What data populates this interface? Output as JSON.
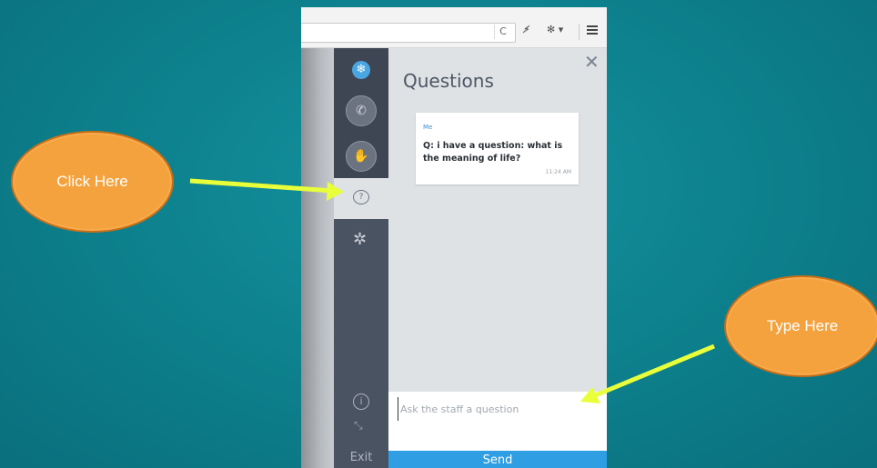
{
  "toolbar": {
    "reload_glyph": "C",
    "extension_glyph": "⚡̸",
    "extra_glyph": "✻ ▾"
  },
  "sidebar": {
    "logo_glyph": "❄",
    "phone_glyph": "✆",
    "hand_glyph": "✋",
    "questions_glyph": "?",
    "settings_glyph": "✲",
    "info_glyph": "i",
    "expand_glyph": "⤡",
    "exit_label": "Exit"
  },
  "panel": {
    "title": "Questions",
    "close_glyph": "✕",
    "message": {
      "author": "Me",
      "prefix": "Q:",
      "text": "i have a question: what is the meaning of life?",
      "time": "11:24 AM"
    },
    "input_placeholder": "Ask the staff a question",
    "send_label": "Send"
  },
  "annotations": {
    "left_label": "Click Here",
    "right_label": "Type Here",
    "arrow_color": "#e8ff3a",
    "bubble_color": "#f4a23d"
  }
}
